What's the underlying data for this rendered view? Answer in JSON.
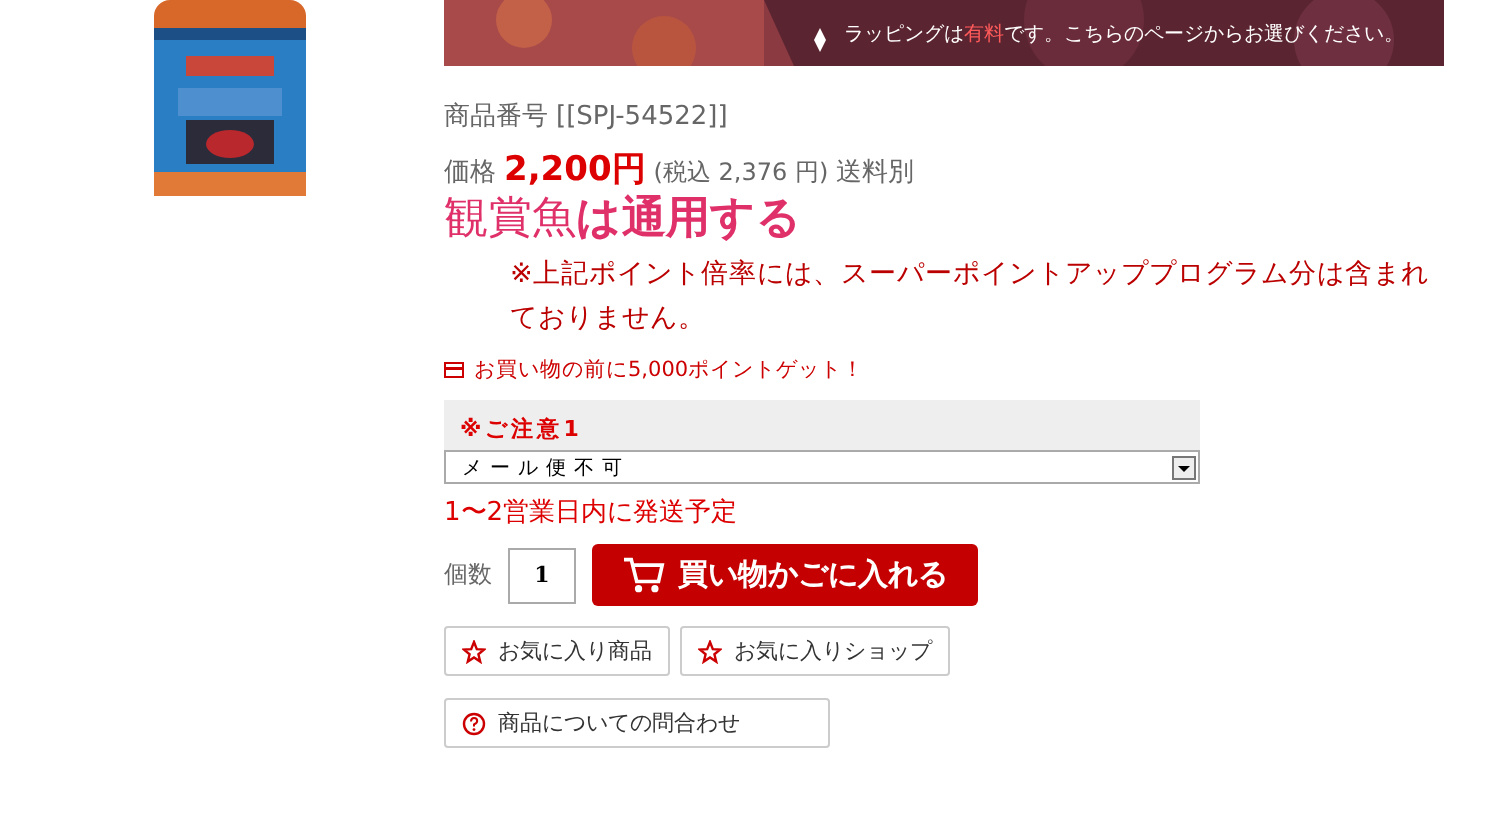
{
  "banner": {
    "caption": [
      {
        "text": "ラッピングは",
        "highlight": false
      },
      {
        "text": "有料",
        "highlight": true
      },
      {
        "text": "です。こちらのページからお選びください。",
        "highlight": false
      }
    ]
  },
  "product_number": {
    "label": "商品番号",
    "value": "[[SPJ-54522]]"
  },
  "price": {
    "label": "価格",
    "amount": "2,200円",
    "tax_note": "(税込 2,376 円)",
    "shipping": "送料別"
  },
  "headline": {
    "normal": "観賞魚",
    "bold": "は通用する"
  },
  "point_note": "※上記ポイント倍率には、スーパーポイントアッププログラム分は含まれておりません。",
  "point_campaign": "お買い物の前に5,000ポイントゲット！",
  "option": {
    "title": "※ご注意1",
    "value": "メール便不可"
  },
  "shipping_note": "1〜2営業日内に発送予定",
  "quantity": {
    "label": "個数",
    "value": "1"
  },
  "cart_button": "買い物かごに入れる",
  "favorite_buttons": [
    "お気に入り商品",
    "お気に入りショップ"
  ],
  "inquiry_button": "商品についての問合わせ"
}
